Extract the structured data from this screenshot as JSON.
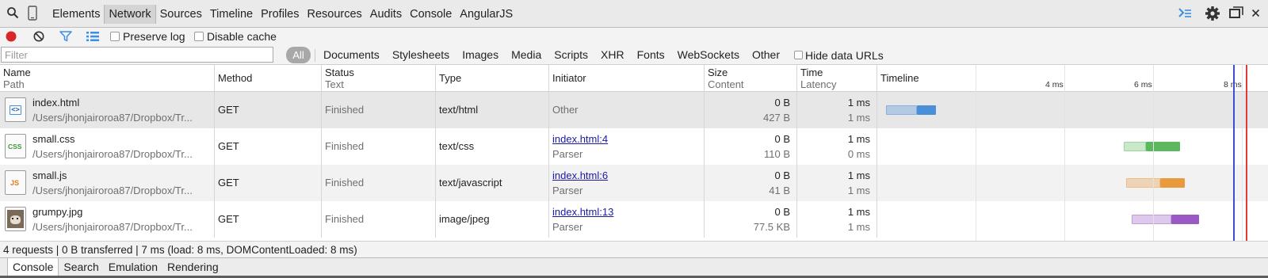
{
  "tabs": [
    "Elements",
    "Network",
    "Sources",
    "Timeline",
    "Profiles",
    "Resources",
    "Audits",
    "Console",
    "AngularJS"
  ],
  "active_tab": "Network",
  "toolbar": {
    "preserve_log": "Preserve log",
    "disable_cache": "Disable cache"
  },
  "filter": {
    "placeholder": "Filter",
    "all": "All",
    "types": [
      "Documents",
      "Stylesheets",
      "Images",
      "Media",
      "Scripts",
      "XHR",
      "Fonts",
      "WebSockets",
      "Other"
    ],
    "hide_data_urls": "Hide data URLs"
  },
  "headers": {
    "name": "Name",
    "path": "Path",
    "method": "Method",
    "status": "Status",
    "text": "Text",
    "type": "Type",
    "initiator": "Initiator",
    "size": "Size",
    "content": "Content",
    "time": "Time",
    "latency": "Latency",
    "timeline": "Timeline",
    "ticks": [
      "4 ms",
      "6 ms",
      "8 ms"
    ]
  },
  "rows": [
    {
      "name": "index.html",
      "path": "/Users/jhonjairoroa87/Dropbox/Tr...",
      "method": "GET",
      "status": "Finished",
      "type": "text/html",
      "initiator": "Other",
      "initiator_link": "",
      "initiator_sub": "",
      "size": "0 B",
      "content": "427 B",
      "time": "1 ms",
      "latency": "1 ms",
      "icon": "html-file-icon"
    },
    {
      "name": "small.css",
      "path": "/Users/jhonjairoroa87/Dropbox/Tr...",
      "method": "GET",
      "status": "Finished",
      "type": "text/css",
      "initiator": "",
      "initiator_link": "index.html:4",
      "initiator_sub": "Parser",
      "size": "0 B",
      "content": "110 B",
      "time": "1 ms",
      "latency": "0 ms",
      "icon": "css-file-icon"
    },
    {
      "name": "small.js",
      "path": "/Users/jhonjairoroa87/Dropbox/Tr...",
      "method": "GET",
      "status": "Finished",
      "type": "text/javascript",
      "initiator": "",
      "initiator_link": "index.html:6",
      "initiator_sub": "Parser",
      "size": "0 B",
      "content": "41 B",
      "time": "1 ms",
      "latency": "1 ms",
      "icon": "js-file-icon"
    },
    {
      "name": "grumpy.jpg",
      "path": "/Users/jhonjairoroa87/Dropbox/Tr...",
      "method": "GET",
      "status": "Finished",
      "type": "image/jpeg",
      "initiator": "",
      "initiator_link": "index.html:13",
      "initiator_sub": "Parser",
      "size": "0 B",
      "content": "77.5 KB",
      "time": "1 ms",
      "latency": "1 ms",
      "icon": "image-thumbnail-icon"
    }
  ],
  "icon_labels": {
    "html": "<>",
    "css": "CSS",
    "js": "JS"
  },
  "colors": {
    "html": "#4a8fd9",
    "css": "#5cb85c",
    "js": "#e89a3c",
    "img": "#9b59c6",
    "load_line": "#e03b3b",
    "dcl_line": "#3b4ed8",
    "record": "#d9262a",
    "accent": "#3a8ee6"
  },
  "status": "4 requests | 0 B transferred | 7 ms (load: 8 ms, DOMContentLoaded: 8 ms)",
  "drawer_tabs": [
    "Console",
    "Search",
    "Emulation",
    "Rendering"
  ],
  "drawer_active": "Console"
}
